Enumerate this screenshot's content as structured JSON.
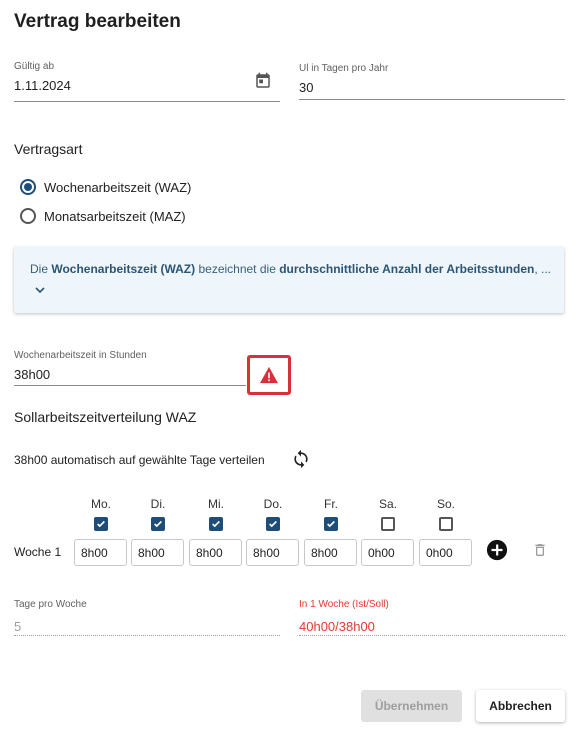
{
  "dialog": {
    "title": "Vertrag bearbeiten"
  },
  "fields": {
    "valid_from": {
      "label": "Gültig ab",
      "value": "1.11.2024"
    },
    "vacation_days": {
      "label": "Ul in Tagen pro Jahr",
      "value": "30"
    }
  },
  "contract_type": {
    "heading": "Vertragsart",
    "options": [
      {
        "label": "Wochenarbeitszeit (WAZ)",
        "selected": true
      },
      {
        "label": "Monatsarbeitszeit (MAZ)",
        "selected": false
      }
    ]
  },
  "info": {
    "part1": "Die ",
    "bold1": "Wochenarbeitszeit (WAZ)",
    "part2": " bezeichnet die ",
    "bold2": "durchschnittliche Anzahl der Arbeitsstunden",
    "part3": ", ..."
  },
  "weekly_hours": {
    "label": "Wochenarbeitszeit in Stunden",
    "value": "38h00"
  },
  "distribution": {
    "heading": "Sollarbeitszeitverteilung WAZ",
    "auto_text": "38h00 automatisch auf gewählte Tage verteilen",
    "week_label": "Woche 1",
    "days": [
      {
        "label": "Mo.",
        "checked": true,
        "hours": "8h00"
      },
      {
        "label": "Di.",
        "checked": true,
        "hours": "8h00"
      },
      {
        "label": "Mi.",
        "checked": true,
        "hours": "8h00"
      },
      {
        "label": "Do.",
        "checked": true,
        "hours": "8h00"
      },
      {
        "label": "Fr.",
        "checked": true,
        "hours": "8h00"
      },
      {
        "label": "Sa.",
        "checked": false,
        "hours": "0h00"
      },
      {
        "label": "So.",
        "checked": false,
        "hours": "0h00"
      }
    ]
  },
  "summary": {
    "days_per_week": {
      "label": "Tage pro Woche",
      "value": "5"
    },
    "week_ratio": {
      "label": "In 1 Woche (Ist/Soll)",
      "value": "40h00/38h00"
    }
  },
  "buttons": {
    "apply": "Übernehmen",
    "cancel": "Abbrechen"
  },
  "colors": {
    "accent": "#1e4d7a",
    "error": "#e53935",
    "warning_outline": "#d9303b",
    "info_bg": "#eef6fb"
  },
  "icons": [
    "calendar-icon",
    "warning-icon",
    "chevron-down-icon",
    "sync-icon",
    "add-circle-icon",
    "trash-icon",
    "check-icon"
  ]
}
